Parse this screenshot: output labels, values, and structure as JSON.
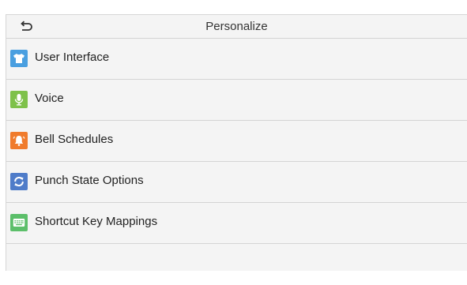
{
  "header": {
    "title": "Personalize",
    "back_icon": "back-arrow-icon"
  },
  "menu": {
    "items": [
      {
        "label": "User Interface",
        "icon": "tshirt-icon",
        "color": "#4a9fe0"
      },
      {
        "label": "Voice",
        "icon": "microphone-icon",
        "color": "#7ec14a"
      },
      {
        "label": "Bell Schedules",
        "icon": "bell-icon",
        "color": "#f07b2c"
      },
      {
        "label": "Punch State Options",
        "icon": "cycle-arrows-icon",
        "color": "#4f7cc9"
      },
      {
        "label": "Shortcut Key Mappings",
        "icon": "keyboard-icon",
        "color": "#5cbf6a"
      }
    ]
  }
}
